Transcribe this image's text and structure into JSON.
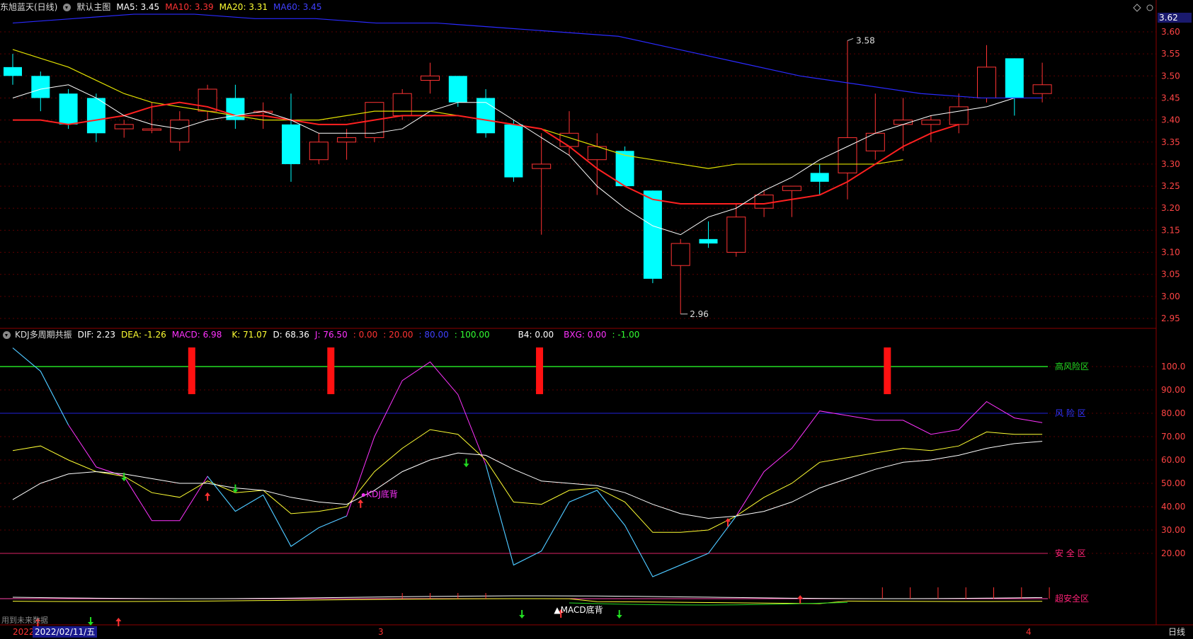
{
  "main_header": {
    "stock": "东旭蓝天(日线)",
    "template": "默认主图",
    "ma5": {
      "label": "MA5:",
      "value": "3.45",
      "color": "#ffffff"
    },
    "ma10": {
      "label": "MA10:",
      "value": "3.39",
      "color": "#ff3333"
    },
    "ma20": {
      "label": "MA20:",
      "value": "3.31",
      "color": "#ffff33"
    },
    "ma60": {
      "label": "MA60:",
      "value": "3.45",
      "color": "#3333ff"
    }
  },
  "current_price": "3.62",
  "price_axis": [
    "3.60",
    "3.55",
    "3.50",
    "3.45",
    "3.40",
    "3.35",
    "3.30",
    "3.25",
    "3.20",
    "3.15",
    "3.10",
    "3.05",
    "3.00",
    "2.95"
  ],
  "price_annotations": {
    "high": "3.58",
    "low": "2.96"
  },
  "candles": [
    [
      3.52,
      3.5,
      3.55,
      3.48
    ],
    [
      3.5,
      3.45,
      3.51,
      3.42
    ],
    [
      3.46,
      3.39,
      3.47,
      3.38
    ],
    [
      3.45,
      3.37,
      3.46,
      3.35
    ],
    [
      3.38,
      3.39,
      3.4,
      3.36
    ],
    [
      3.38,
      3.38,
      3.44,
      3.37
    ],
    [
      3.35,
      3.4,
      3.42,
      3.33
    ],
    [
      3.42,
      3.47,
      3.48,
      3.4
    ],
    [
      3.45,
      3.4,
      3.48,
      3.38
    ],
    [
      3.42,
      3.42,
      3.44,
      3.38
    ],
    [
      3.39,
      3.3,
      3.46,
      3.26
    ],
    [
      3.31,
      3.35,
      3.37,
      3.3
    ],
    [
      3.35,
      3.36,
      3.38,
      3.31
    ],
    [
      3.36,
      3.44,
      3.44,
      3.35
    ],
    [
      3.41,
      3.46,
      3.47,
      3.4
    ],
    [
      3.49,
      3.5,
      3.53,
      3.46
    ],
    [
      3.5,
      3.44,
      3.5,
      3.43
    ],
    [
      3.45,
      3.37,
      3.47,
      3.36
    ],
    [
      3.39,
      3.27,
      3.4,
      3.26
    ],
    [
      3.29,
      3.3,
      3.37,
      3.14
    ],
    [
      3.34,
      3.37,
      3.42,
      3.32
    ],
    [
      3.31,
      3.34,
      3.37,
      3.23
    ],
    [
      3.33,
      3.25,
      3.34,
      3.25
    ],
    [
      3.24,
      3.04,
      3.24,
      3.03
    ],
    [
      3.07,
      3.12,
      3.13,
      2.96
    ],
    [
      3.13,
      3.12,
      3.17,
      3.11
    ],
    [
      3.1,
      3.18,
      3.21,
      3.09
    ],
    [
      3.2,
      3.23,
      3.24,
      3.18
    ],
    [
      3.24,
      3.25,
      3.25,
      3.18
    ],
    [
      3.28,
      3.26,
      3.3,
      3.23
    ],
    [
      3.28,
      3.36,
      3.58,
      3.22
    ],
    [
      3.33,
      3.37,
      3.46,
      3.31
    ],
    [
      3.39,
      3.4,
      3.45,
      3.33
    ],
    [
      3.39,
      3.4,
      3.41,
      3.35
    ],
    [
      3.39,
      3.43,
      3.46,
      3.37
    ],
    [
      3.45,
      3.52,
      3.57,
      3.44
    ],
    [
      3.54,
      3.45,
      3.54,
      3.41
    ],
    [
      3.46,
      3.48,
      3.53,
      3.44
    ]
  ],
  "ma_lines": {
    "ma5": [
      3.45,
      3.47,
      3.48,
      3.45,
      3.41,
      3.39,
      3.38,
      3.4,
      3.41,
      3.42,
      3.4,
      3.37,
      3.37,
      3.37,
      3.38,
      3.42,
      3.44,
      3.44,
      3.4,
      3.36,
      3.32,
      3.25,
      3.2,
      3.16,
      3.14,
      3.18,
      3.2,
      3.24,
      3.27,
      3.31,
      3.34,
      3.37,
      3.39,
      3.41,
      3.42,
      3.43,
      3.45
    ],
    "ma10": [
      3.4,
      3.4,
      3.39,
      3.4,
      3.41,
      3.43,
      3.44,
      3.43,
      3.41,
      3.41,
      3.4,
      3.39,
      3.39,
      3.4,
      3.41,
      3.41,
      3.41,
      3.4,
      3.39,
      3.38,
      3.34,
      3.29,
      3.25,
      3.22,
      3.21,
      3.21,
      3.21,
      3.21,
      3.22,
      3.23,
      3.26,
      3.3,
      3.34,
      3.37,
      3.39
    ],
    "ma20": [
      3.56,
      3.54,
      3.52,
      3.49,
      3.46,
      3.44,
      3.43,
      3.42,
      3.41,
      3.4,
      3.4,
      3.4,
      3.41,
      3.42,
      3.42,
      3.42,
      3.41,
      3.4,
      3.39,
      3.38,
      3.36,
      3.34,
      3.32,
      3.31,
      3.3,
      3.29,
      3.3,
      3.3,
      3.3,
      3.3,
      3.3,
      3.3,
      3.31
    ],
    "ma60": [
      3.62,
      3.63,
      3.64,
      3.64,
      3.63,
      3.63,
      3.62,
      3.62,
      3.61,
      3.6,
      3.59,
      3.56,
      3.53,
      3.5,
      3.48,
      3.46,
      3.45,
      3.45
    ]
  },
  "kdj_header": {
    "name": "KDJ多周期共振",
    "dif": {
      "label": "DIF:",
      "value": "2.23",
      "color": "#ffffff"
    },
    "dea": {
      "label": "DEA:",
      "value": "-1.26",
      "color": "#ffff33"
    },
    "macd": {
      "label": "MACD:",
      "value": "6.98",
      "color": "#ff33ff"
    },
    "k": {
      "label": "K:",
      "value": "71.07",
      "color": "#ffff33"
    },
    "d": {
      "label": "D:",
      "value": "68.36",
      "color": "#ffffff"
    },
    "j": {
      "label": "J:",
      "value": "76.50",
      "color": "#ff33ff"
    },
    "l1": {
      "label": ":",
      "value": "0.00",
      "color": "#ff3333"
    },
    "l2": {
      "label": ":",
      "value": "20.00",
      "color": "#ff3333"
    },
    "l3": {
      "label": ":",
      "value": "80.00",
      "color": "#3333ff"
    },
    "l4": {
      "label": ":",
      "value": "100.00",
      "color": "#33ff33"
    },
    "b4": {
      "label": "B4:",
      "value": "0.00",
      "color": "#ffffff"
    },
    "bxg": {
      "label": "BXG:",
      "value": "0.00",
      "color": "#ff33ff"
    },
    "l5": {
      "label": ":",
      "value": "-1.00",
      "color": "#33ff33"
    }
  },
  "kdj_axis": [
    "100.0",
    "90.00",
    "80.00",
    "70.00",
    "60.00",
    "50.00",
    "40.00",
    "30.00",
    "20.00"
  ],
  "zones": {
    "high_risk": "高风险区",
    "risk": "风 险 区",
    "safe": "安 全 区",
    "super_safe": "超安全区"
  },
  "signals": {
    "kdj_divergence": "KDJ底背",
    "macd_divergence": "▲MACD底背"
  },
  "kdj_series": {
    "k": [
      64,
      66,
      60,
      55,
      53,
      46,
      44,
      51,
      46,
      47,
      37,
      38,
      40,
      55,
      65,
      73,
      71,
      60,
      42,
      41,
      47,
      48,
      42,
      29,
      29,
      30,
      36,
      44,
      50,
      59,
      61,
      63,
      65,
      64,
      66,
      72,
      71,
      71
    ],
    "d": [
      43,
      50,
      54,
      55,
      54,
      52,
      50,
      50,
      48,
      47,
      44,
      42,
      41,
      47,
      55,
      60,
      63,
      62,
      56,
      51,
      50,
      49,
      46,
      41,
      37,
      35,
      36,
      38,
      42,
      48,
      52,
      56,
      59,
      60,
      62,
      65,
      67,
      68
    ],
    "j": [
      108,
      98,
      75,
      57,
      53,
      34,
      34,
      53,
      38,
      45,
      23,
      31,
      36,
      70,
      94,
      102,
      88,
      58,
      15,
      21,
      42,
      47,
      32,
      10,
      15,
      20,
      36,
      55,
      65,
      81,
      79,
      77,
      77,
      71,
      73,
      85,
      78,
      76
    ],
    "cyan": [
      null,
      null,
      null,
      null,
      null,
      null,
      null,
      null,
      null,
      null,
      null,
      null,
      null,
      null,
      null,
      null,
      null,
      60,
      15,
      21,
      42,
      47,
      32,
      10,
      15,
      20,
      36,
      null,
      null,
      null,
      null,
      null,
      null,
      null,
      null,
      null,
      null,
      null
    ]
  },
  "bottom_bar": {
    "status": "用到未来数据",
    "date_start": "2022",
    "date_selected": "2022/02/11/五",
    "month_mark_1": "3",
    "month_mark_2": "4",
    "period": "日线"
  }
}
